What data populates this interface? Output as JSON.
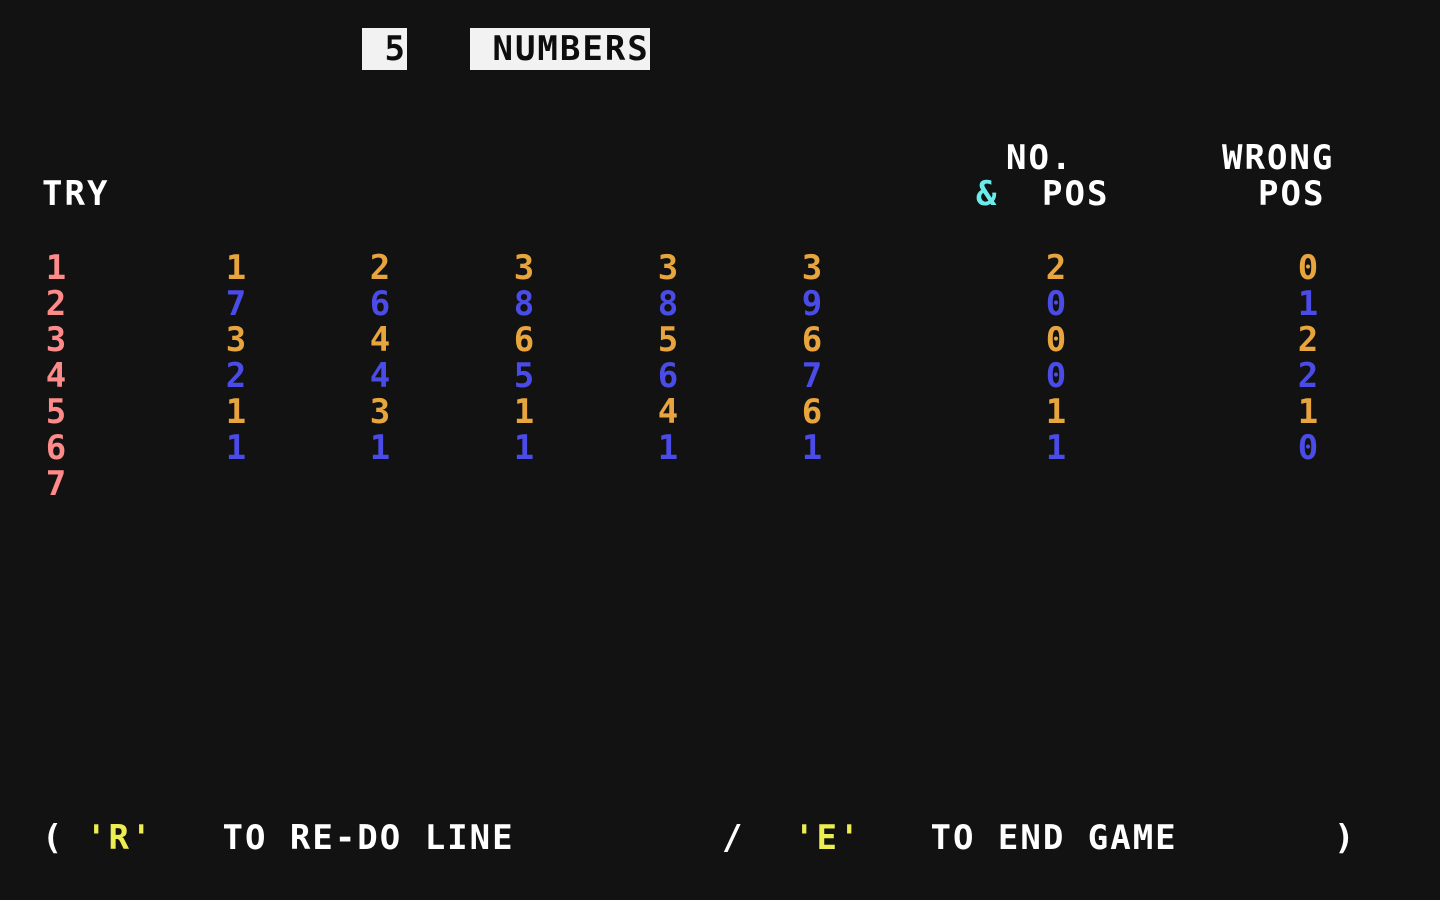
{
  "screen": {
    "background_color": "#121212",
    "title_blocks": [
      {
        "text": " 5",
        "style": "inverse"
      },
      {
        "text": " NUMBERS",
        "style": "inverse"
      }
    ],
    "title_plain": "5 NUMBERS"
  },
  "headers": {
    "try_label": "TRY",
    "no_and_pos": {
      "line1": "NO.",
      "ampersand": "&",
      "line2": "POS"
    },
    "wrong_pos": {
      "line1": "WRONG",
      "line2": "POS"
    }
  },
  "colors": {
    "white": "#FFFFFF",
    "light_red": "#FF8A8A",
    "orange": "#E9A53D",
    "blue": "#4B4BE8",
    "cyan": "#6BECEC",
    "yellow": "#EDED52",
    "background": "#121212",
    "inverse_bg": "#F2F2F2",
    "inverse_fg": "#0D0D0D"
  },
  "board": {
    "row_numbers": [
      "1",
      "2",
      "3",
      "4",
      "5",
      "6",
      "7"
    ],
    "rows": [
      {
        "try": "1",
        "color": "orange",
        "guess": [
          "1",
          "2",
          "3",
          "3",
          "3"
        ],
        "no_and_pos": "2",
        "wrong_pos": "0"
      },
      {
        "try": "2",
        "color": "blue",
        "guess": [
          "7",
          "6",
          "8",
          "8",
          "9"
        ],
        "no_and_pos": "0",
        "wrong_pos": "1"
      },
      {
        "try": "3",
        "color": "orange",
        "guess": [
          "3",
          "4",
          "6",
          "5",
          "6"
        ],
        "no_and_pos": "0",
        "wrong_pos": "2"
      },
      {
        "try": "4",
        "color": "blue",
        "guess": [
          "2",
          "4",
          "5",
          "6",
          "7"
        ],
        "no_and_pos": "0",
        "wrong_pos": "2"
      },
      {
        "try": "5",
        "color": "orange",
        "guess": [
          "1",
          "3",
          "1",
          "4",
          "6"
        ],
        "no_and_pos": "1",
        "wrong_pos": "1"
      },
      {
        "try": "6",
        "color": "blue",
        "guess": [
          "1",
          "1",
          "1",
          "1",
          "1"
        ],
        "no_and_pos": "1",
        "wrong_pos": "0"
      },
      {
        "try": "7",
        "color": "none",
        "guess": [
          "",
          "",
          "",
          "",
          ""
        ],
        "no_and_pos": "",
        "wrong_pos": ""
      }
    ]
  },
  "prompt": {
    "open_paren": "(",
    "key_redo": "'R'",
    "text_redo": " TO RE-DO LINE ",
    "separator": "/",
    "key_end": "'E'",
    "text_end": " TO END GAME",
    "close_paren": ")",
    "full_text": "('R' TO RE-DO LINE / 'E' TO END GAME)"
  }
}
